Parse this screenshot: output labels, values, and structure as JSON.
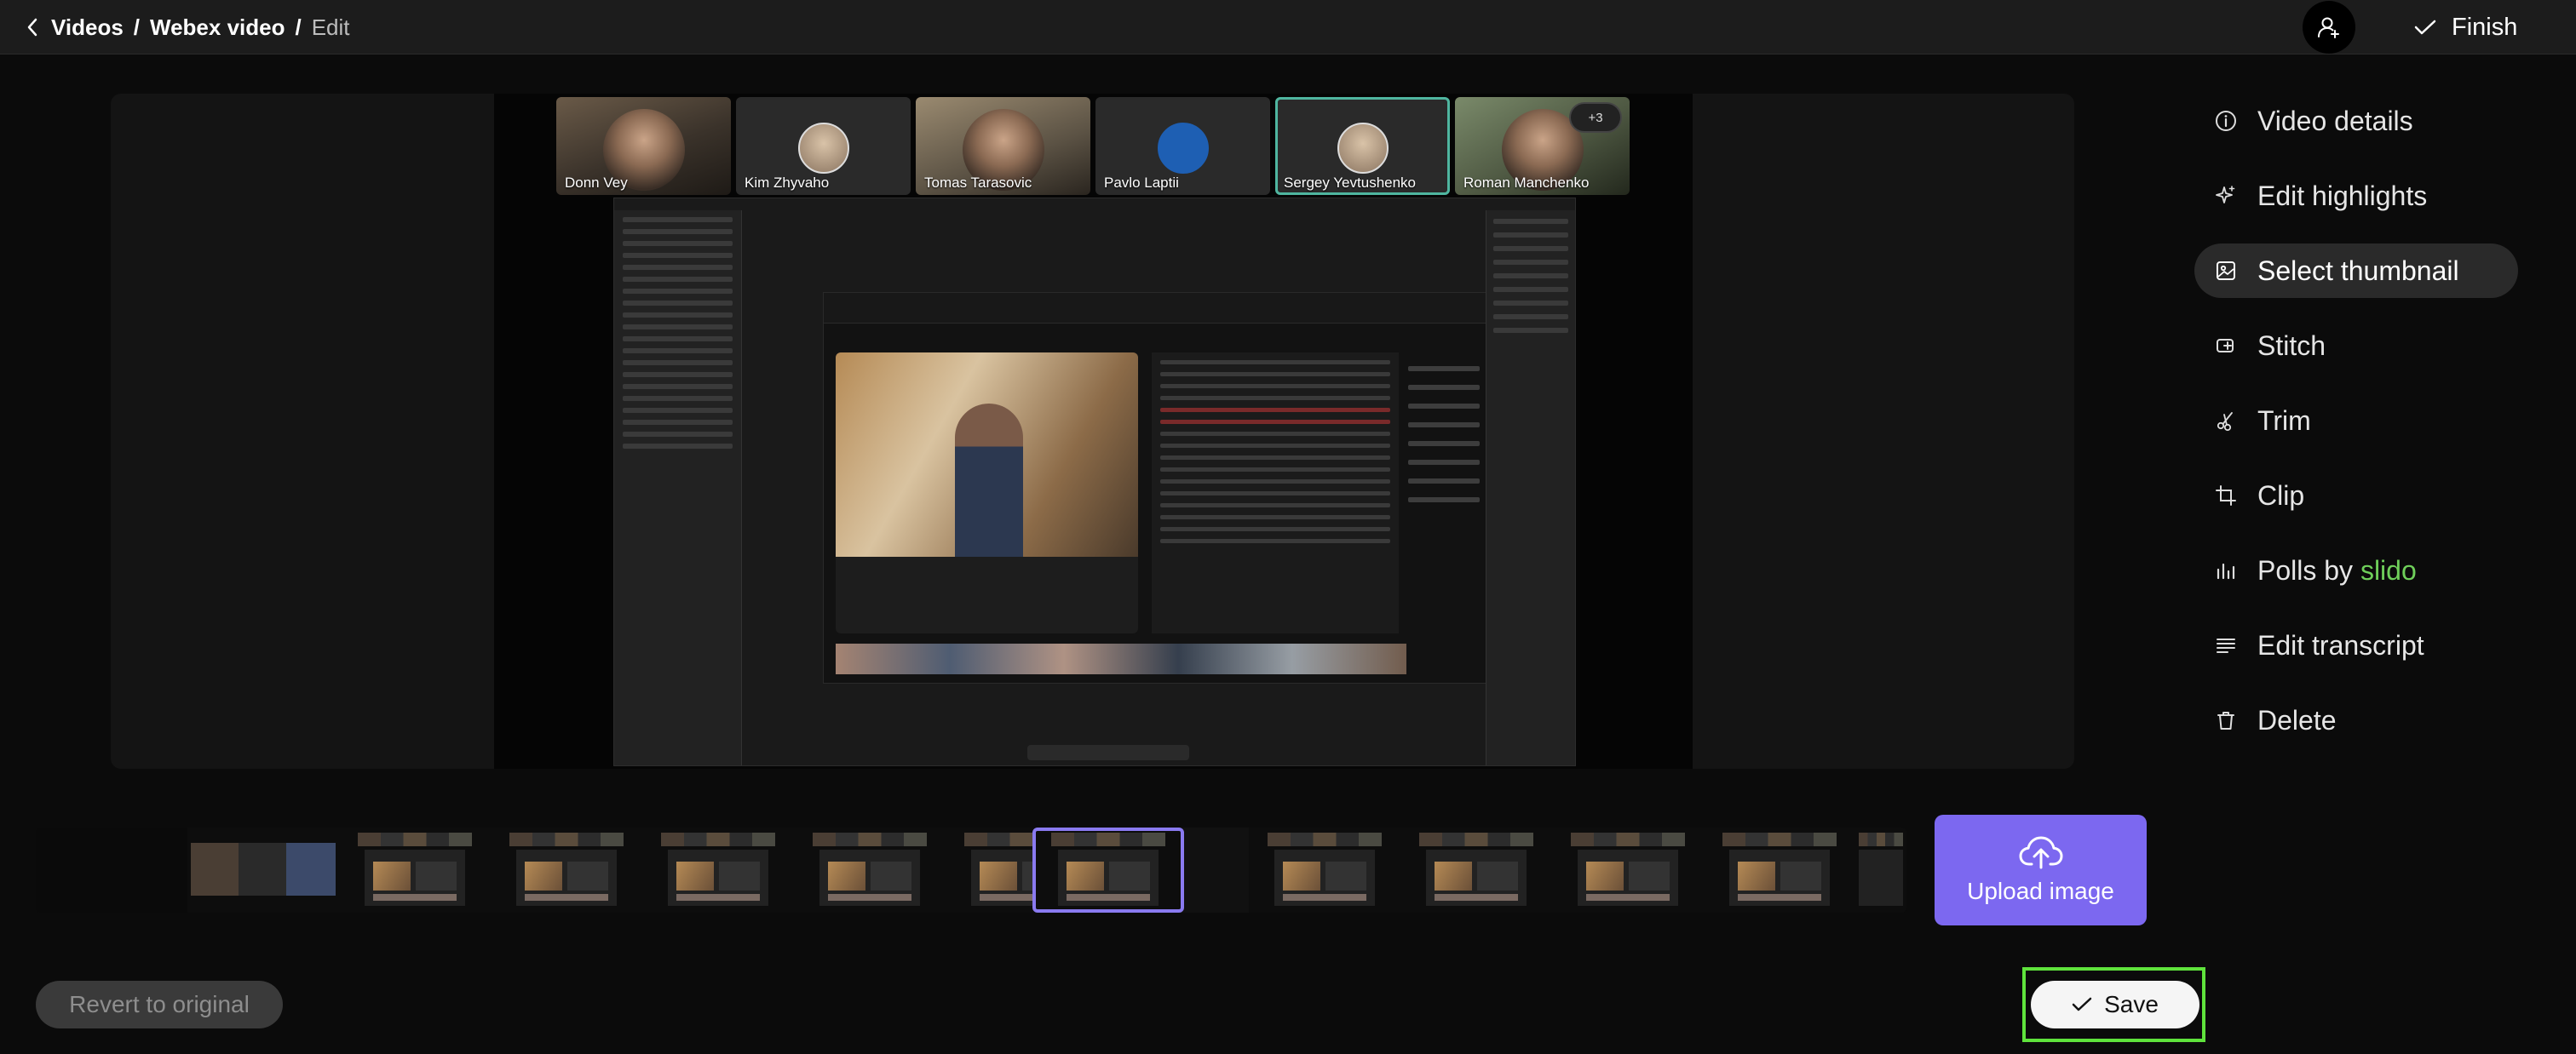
{
  "breadcrumb": {
    "items": [
      "Videos",
      "Webex video"
    ],
    "separator": "/",
    "current": "Edit"
  },
  "header": {
    "finish_label": "Finish"
  },
  "participants": [
    {
      "name": "Donn Vey"
    },
    {
      "name": "Kim Zhyvaho"
    },
    {
      "name": "Tomas Tarasovic"
    },
    {
      "name": "Pavlo Laptii"
    },
    {
      "name": "Sergey Yevtushenko"
    },
    {
      "name": "Roman Manchenko"
    }
  ],
  "more_participants": "+3",
  "menu": {
    "video_details": "Video details",
    "edit_highlights": "Edit highlights",
    "select_thumbnail": "Select thumbnail",
    "stitch": "Stitch",
    "trim": "Trim",
    "clip": "Clip",
    "polls_by": "Polls by ",
    "polls_brand": "slido",
    "edit_transcript": "Edit transcript",
    "delete": "Delete"
  },
  "upload": {
    "label": "Upload image"
  },
  "footer": {
    "revert_label": "Revert to original",
    "save_label": "Save"
  },
  "colors": {
    "accent": "#7c68f0",
    "slido_green": "#6fcf5a",
    "highlight_outline": "#5fe33c",
    "active_speaker": "#4fb6a0"
  },
  "icons": {
    "back": "chevron-left-icon",
    "user": "add-user-icon",
    "finish": "check-icon",
    "upload": "cloud-upload-icon",
    "save": "check-icon"
  }
}
